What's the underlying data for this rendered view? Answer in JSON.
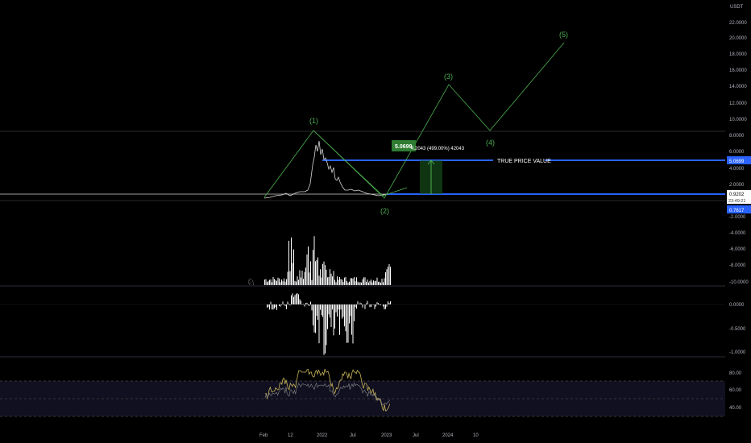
{
  "colors": {
    "background": "#000000",
    "wave_line": "#4caf50",
    "target_line": "#2962ff",
    "price_line": "#e0e0e0",
    "volume": "#ffffff",
    "rsi_line": "#c8b45a",
    "rsi_band": "#1e1e3a"
  },
  "main": {
    "unit_label": "USDT",
    "price_ticks": [
      "22.0000",
      "20.0000",
      "18.0000",
      "16.0000",
      "14.0000",
      "12.0000",
      "10.0000",
      "8.0000",
      "6.0000",
      "4.0000",
      "2.0000",
      "-2.0000",
      "-4.0000",
      "-6.0000",
      "-8.0000",
      "-10.0000"
    ],
    "target_label": "TRUE PRICE VALUE",
    "target_value_tag": "5.0699",
    "current_price_tag": "0.9202",
    "countdown_tag": "23:49:21",
    "low_tag": "0.7617",
    "measure_box": "5.0699",
    "measure_text": "4.2043 (499.00%) 42043"
  },
  "waves": [
    {
      "label": "(1)"
    },
    {
      "label": "(2)"
    },
    {
      "label": "(3)"
    },
    {
      "label": "(4)"
    },
    {
      "label": "(5)"
    }
  ],
  "oscillator": {
    "ticks": [
      "0.0000",
      "-0.5000",
      "-1.0000"
    ]
  },
  "rsi": {
    "ticks": [
      "80.00",
      "60.00",
      "40.00"
    ]
  },
  "time_axis": [
    "Feb",
    "12",
    "2022",
    "Jul",
    "2023",
    "Jul",
    "2024",
    "10"
  ],
  "chart_data": [
    {
      "type": "line",
      "title": "",
      "series": [
        {
          "name": "",
          "x": [
            "2021-01",
            "2021-03",
            "2021-06",
            "2021-09",
            "2021-11",
            "2021-12",
            "2022-01",
            "2022-03",
            "2022-06",
            "2022-09",
            "2022-12",
            "2023-01"
          ],
          "values": [
            0.2,
            0.3,
            0.5,
            1.0,
            1.2,
            7.0,
            5.5,
            3.6,
            2.0,
            1.4,
            0.8,
            0.92
          ]
        }
      ],
      "annotations": [
        {
          "label": "(1)",
          "x": "2021-12",
          "y": 8.6
        },
        {
          "label": "(2)",
          "x": "2023-01",
          "y": 0.76
        },
        {
          "label": "(3)",
          "x": "2023-09",
          "y": 13.9
        },
        {
          "label": "(4)",
          "x": "2024-06",
          "y": 8.6
        },
        {
          "label": "(5)",
          "x": "2025-03",
          "y": 19.4
        }
      ],
      "horizontal_lines": [
        {
          "label": "TRUE PRICE VALUE",
          "y": 5.0699
        },
        {
          "y": 0.9202
        }
      ],
      "ylim": [
        -10,
        22
      ]
    },
    {
      "type": "bar",
      "title": "",
      "ylim": [
        -1.0,
        0.0
      ]
    },
    {
      "type": "line",
      "title": "",
      "ylim": [
        30,
        90
      ],
      "bands": [
        70,
        50,
        30
      ]
    }
  ]
}
